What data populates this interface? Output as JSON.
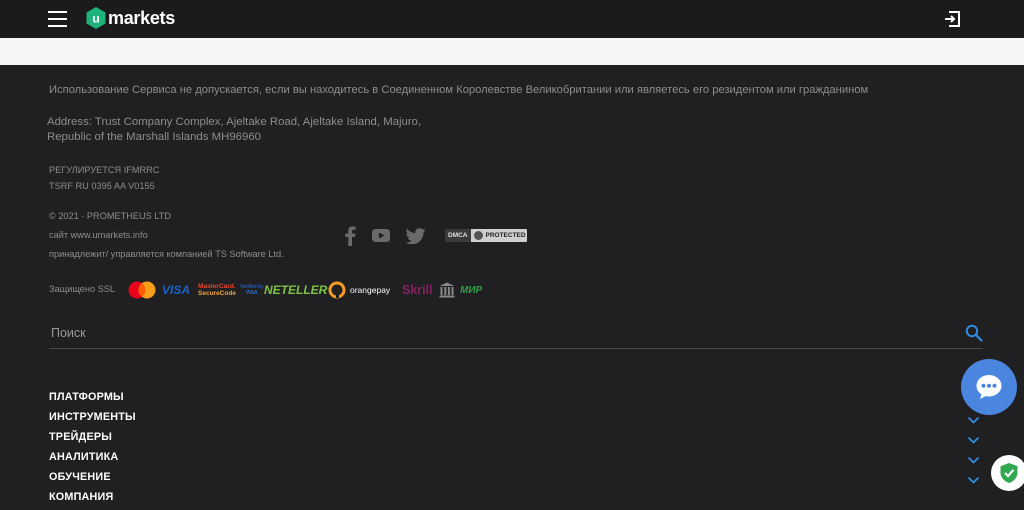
{
  "header": {
    "logo_text": "markets",
    "logo_letter": "u"
  },
  "footer": {
    "notice": "Использование Сервиса не допускается, если вы находитесь в Соединенном Королевстве Великобритании или являетесь его резидентом или гражданином",
    "address_line1": "Address: Trust Company Complex, Ajeltake Road, Ajeltake Island, Majuro,",
    "address_line2": "Republic of the Marshall Islands MH96960",
    "regulated": "РЕГУЛИРУЕТСЯ IFMRRC",
    "tsrf": "TSRF RU 0395 AA V0155",
    "copyright": "© 2021 · PROMETHEUS LTD",
    "site": "сайт www.umarkets.info",
    "owner": "принадлежит/ управляется компанией TS Software Ltd.",
    "dmca_left": "DMCA",
    "dmca_right": "PROTECTED",
    "ssl_label": "Защищено SSL",
    "payments": {
      "visa": "VISA",
      "mc_secure_1": "MasterCard.",
      "mc_secure_2": "SecureCode",
      "vbv_1": "Verified by",
      "vbv_2": "VISA",
      "neteller": "NETELLER",
      "orangepay": "orangepay",
      "skrill": "Skrill",
      "mir": "МИР"
    }
  },
  "search": {
    "placeholder": "Поиск"
  },
  "nav": [
    {
      "label": "ПЛАТФОРМЫ"
    },
    {
      "label": "ИНСТРУМЕНТЫ"
    },
    {
      "label": "ТРЕЙДЕРЫ"
    },
    {
      "label": "АНАЛИТИКА"
    },
    {
      "label": "ОБУЧЕНИЕ"
    },
    {
      "label": "КОМПАНИЯ"
    }
  ],
  "colors": {
    "background": "#201f21",
    "accent": "#2f8de4",
    "chat": "#4a86e0",
    "logo_green": "#1fb27a"
  }
}
